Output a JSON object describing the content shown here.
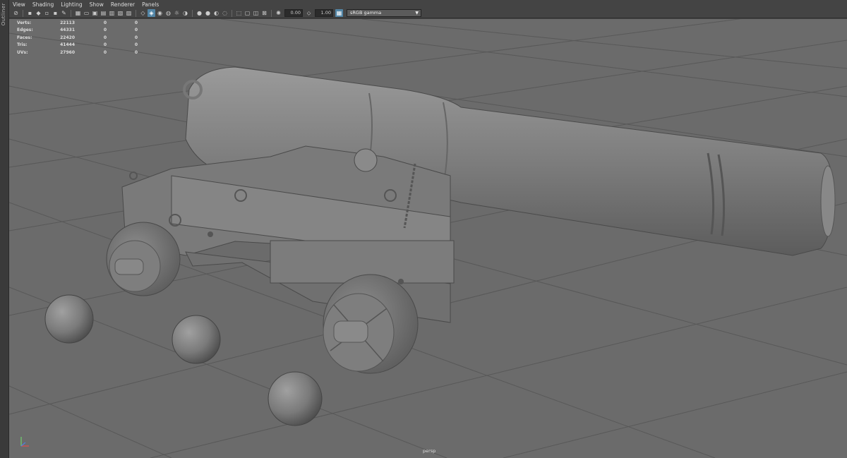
{
  "outliner_tab": "Outliner",
  "menu": [
    "View",
    "Shading",
    "Lighting",
    "Show",
    "Renderer",
    "Panels"
  ],
  "toolbar": {
    "gamma_value": "0.00",
    "exposure_value": "1.00",
    "color_space": "sRGB gamma",
    "icons": [
      "select-camera",
      "camera-attributes",
      "bookmarks",
      "image-plane",
      "2d-pan-zoom",
      "grease-pencil",
      "grid",
      "film-gate",
      "resolution-gate",
      "gate-mask",
      "field-chart",
      "safe-action",
      "safe-title",
      "wireframe",
      "smooth-shade",
      "wireframe-on-shaded",
      "textured",
      "use-all-lights",
      "shadows",
      "screen-space-ao",
      "motion-blur",
      "multisample-aa",
      "depth-of-field",
      "isolate-select",
      "xray",
      "xray-active-components",
      "xray-joints",
      "exposure",
      "gamma",
      "view-transform"
    ]
  },
  "hud": {
    "rows": [
      {
        "label": "Verts:",
        "v1": "22113",
        "v2": "0",
        "v3": "0"
      },
      {
        "label": "Edges:",
        "v1": "44331",
        "v2": "0",
        "v3": "0"
      },
      {
        "label": "Faces:",
        "v1": "22420",
        "v2": "0",
        "v3": "0"
      },
      {
        "label": "Tris:",
        "v1": "41444",
        "v2": "0",
        "v3": "0"
      },
      {
        "label": "UVs:",
        "v1": "27960",
        "v2": "0",
        "v3": "0"
      }
    ]
  },
  "camera_label": "persp",
  "colors": {
    "viewport_bg": "#6b6b6b",
    "grid_line": "#585858",
    "toolbar_active": "#5285a6"
  }
}
